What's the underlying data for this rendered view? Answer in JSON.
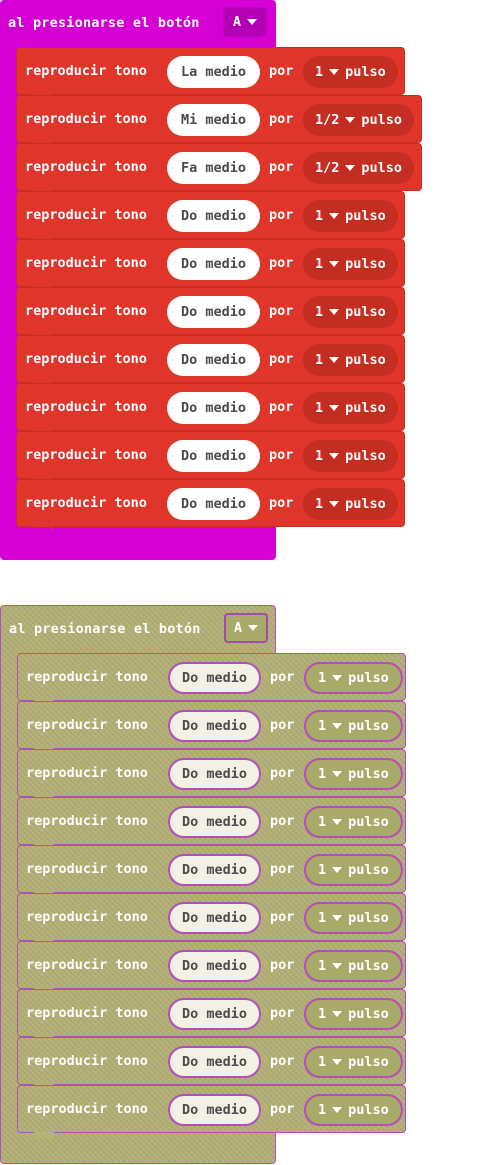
{
  "blocks": [
    {
      "state": "enabled",
      "label": "al presionarse el botón",
      "button": "A",
      "statements": [
        {
          "verb": "reproducir tono",
          "note": "La medio",
          "por": "por",
          "beat": "1",
          "unit": "pulso"
        },
        {
          "verb": "reproducir tono",
          "note": "Mi medio",
          "por": "por",
          "beat": "1/2",
          "unit": "pulso"
        },
        {
          "verb": "reproducir tono",
          "note": "Fa medio",
          "por": "por",
          "beat": "1/2",
          "unit": "pulso"
        },
        {
          "verb": "reproducir tono",
          "note": "Do medio",
          "por": "por",
          "beat": "1",
          "unit": "pulso"
        },
        {
          "verb": "reproducir tono",
          "note": "Do medio",
          "por": "por",
          "beat": "1",
          "unit": "pulso"
        },
        {
          "verb": "reproducir tono",
          "note": "Do medio",
          "por": "por",
          "beat": "1",
          "unit": "pulso"
        },
        {
          "verb": "reproducir tono",
          "note": "Do medio",
          "por": "por",
          "beat": "1",
          "unit": "pulso"
        },
        {
          "verb": "reproducir tono",
          "note": "Do medio",
          "por": "por",
          "beat": "1",
          "unit": "pulso"
        },
        {
          "verb": "reproducir tono",
          "note": "Do medio",
          "por": "por",
          "beat": "1",
          "unit": "pulso"
        },
        {
          "verb": "reproducir tono",
          "note": "Do medio",
          "por": "por",
          "beat": "1",
          "unit": "pulso"
        }
      ]
    },
    {
      "state": "disabled",
      "label": "al presionarse el botón",
      "button": "A",
      "statements": [
        {
          "verb": "reproducir tono",
          "note": "Do medio",
          "por": "por",
          "beat": "1",
          "unit": "pulso"
        },
        {
          "verb": "reproducir tono",
          "note": "Do medio",
          "por": "por",
          "beat": "1",
          "unit": "pulso"
        },
        {
          "verb": "reproducir tono",
          "note": "Do medio",
          "por": "por",
          "beat": "1",
          "unit": "pulso"
        },
        {
          "verb": "reproducir tono",
          "note": "Do medio",
          "por": "por",
          "beat": "1",
          "unit": "pulso"
        },
        {
          "verb": "reproducir tono",
          "note": "Do medio",
          "por": "por",
          "beat": "1",
          "unit": "pulso"
        },
        {
          "verb": "reproducir tono",
          "note": "Do medio",
          "por": "por",
          "beat": "1",
          "unit": "pulso"
        },
        {
          "verb": "reproducir tono",
          "note": "Do medio",
          "por": "por",
          "beat": "1",
          "unit": "pulso"
        },
        {
          "verb": "reproducir tono",
          "note": "Do medio",
          "por": "por",
          "beat": "1",
          "unit": "pulso"
        },
        {
          "verb": "reproducir tono",
          "note": "Do medio",
          "por": "por",
          "beat": "1",
          "unit": "pulso"
        },
        {
          "verb": "reproducir tono",
          "note": "Do medio",
          "por": "por",
          "beat": "1",
          "unit": "pulso"
        }
      ]
    }
  ],
  "colors": {
    "event_block": "#d400d4",
    "music_block": "#e0352b",
    "disabled_block": "#b5b572",
    "disabled_outline": "#b34fbb"
  },
  "icons": {
    "dropdown": "chevron-down-icon"
  }
}
